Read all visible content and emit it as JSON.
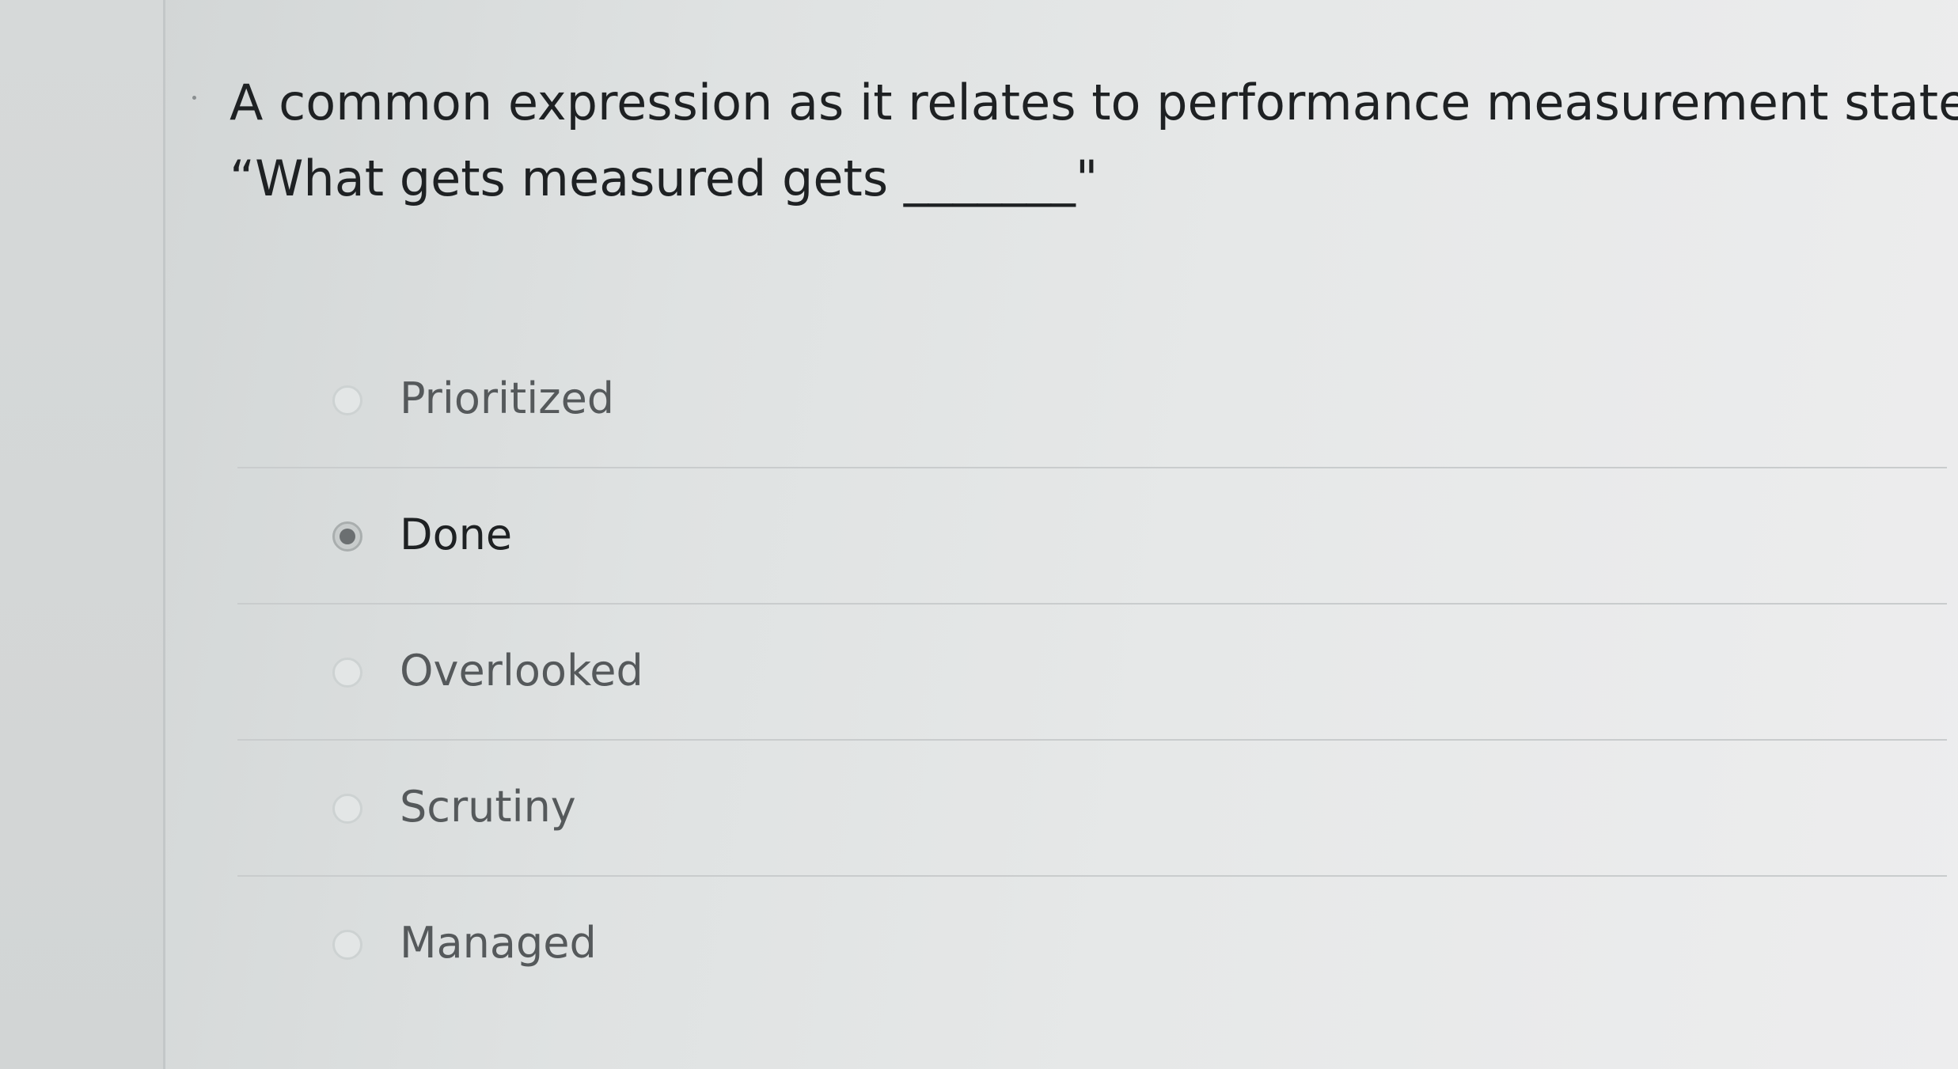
{
  "question": {
    "line1": "A common expression as it relates to performance measurement states:",
    "line2": "“What gets measured gets _______\""
  },
  "answers": [
    {
      "label": "Prioritized",
      "selected": false
    },
    {
      "label": "Done",
      "selected": true
    },
    {
      "label": "Overlooked",
      "selected": false
    },
    {
      "label": "Scrutiny",
      "selected": false
    },
    {
      "label": "Managed",
      "selected": false
    }
  ]
}
